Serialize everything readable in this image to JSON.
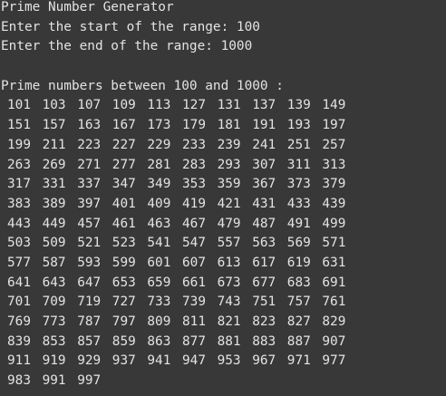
{
  "output": {
    "lines": [
      "Prime Number Generator",
      "Enter the start of the range: 100",
      "Enter the end of the range: 1000"
    ],
    "header": "Prime numbers between 100 and 1000 :",
    "primes": [
      [
        "101",
        "103",
        "107",
        "109",
        "113",
        "127",
        "131",
        "137",
        "139",
        "149"
      ],
      [
        "151",
        "157",
        "163",
        "167",
        "173",
        "179",
        "181",
        "191",
        "193",
        "197"
      ],
      [
        "199",
        "211",
        "223",
        "227",
        "229",
        "233",
        "239",
        "241",
        "251",
        "257"
      ],
      [
        "263",
        "269",
        "271",
        "277",
        "281",
        "283",
        "293",
        "307",
        "311",
        "313"
      ],
      [
        "317",
        "331",
        "337",
        "347",
        "349",
        "353",
        "359",
        "367",
        "373",
        "379"
      ],
      [
        "383",
        "389",
        "397",
        "401",
        "409",
        "419",
        "421",
        "431",
        "433",
        "439"
      ],
      [
        "443",
        "449",
        "457",
        "461",
        "463",
        "467",
        "479",
        "487",
        "491",
        "499"
      ],
      [
        "503",
        "509",
        "521",
        "523",
        "541",
        "547",
        "557",
        "563",
        "569",
        "571"
      ],
      [
        "577",
        "587",
        "593",
        "599",
        "601",
        "607",
        "613",
        "617",
        "619",
        "631"
      ],
      [
        "641",
        "643",
        "647",
        "653",
        "659",
        "661",
        "673",
        "677",
        "683",
        "691"
      ],
      [
        "701",
        "709",
        "719",
        "727",
        "733",
        "739",
        "743",
        "751",
        "757",
        "761"
      ],
      [
        "769",
        "773",
        "787",
        "797",
        "809",
        "811",
        "821",
        "823",
        "827",
        "829"
      ],
      [
        "839",
        "853",
        "857",
        "859",
        "863",
        "877",
        "881",
        "883",
        "887",
        "907"
      ],
      [
        "911",
        "919",
        "929",
        "937",
        "941",
        "947",
        "953",
        "967",
        "971",
        "977"
      ],
      [
        "983",
        "991",
        "997"
      ]
    ]
  }
}
